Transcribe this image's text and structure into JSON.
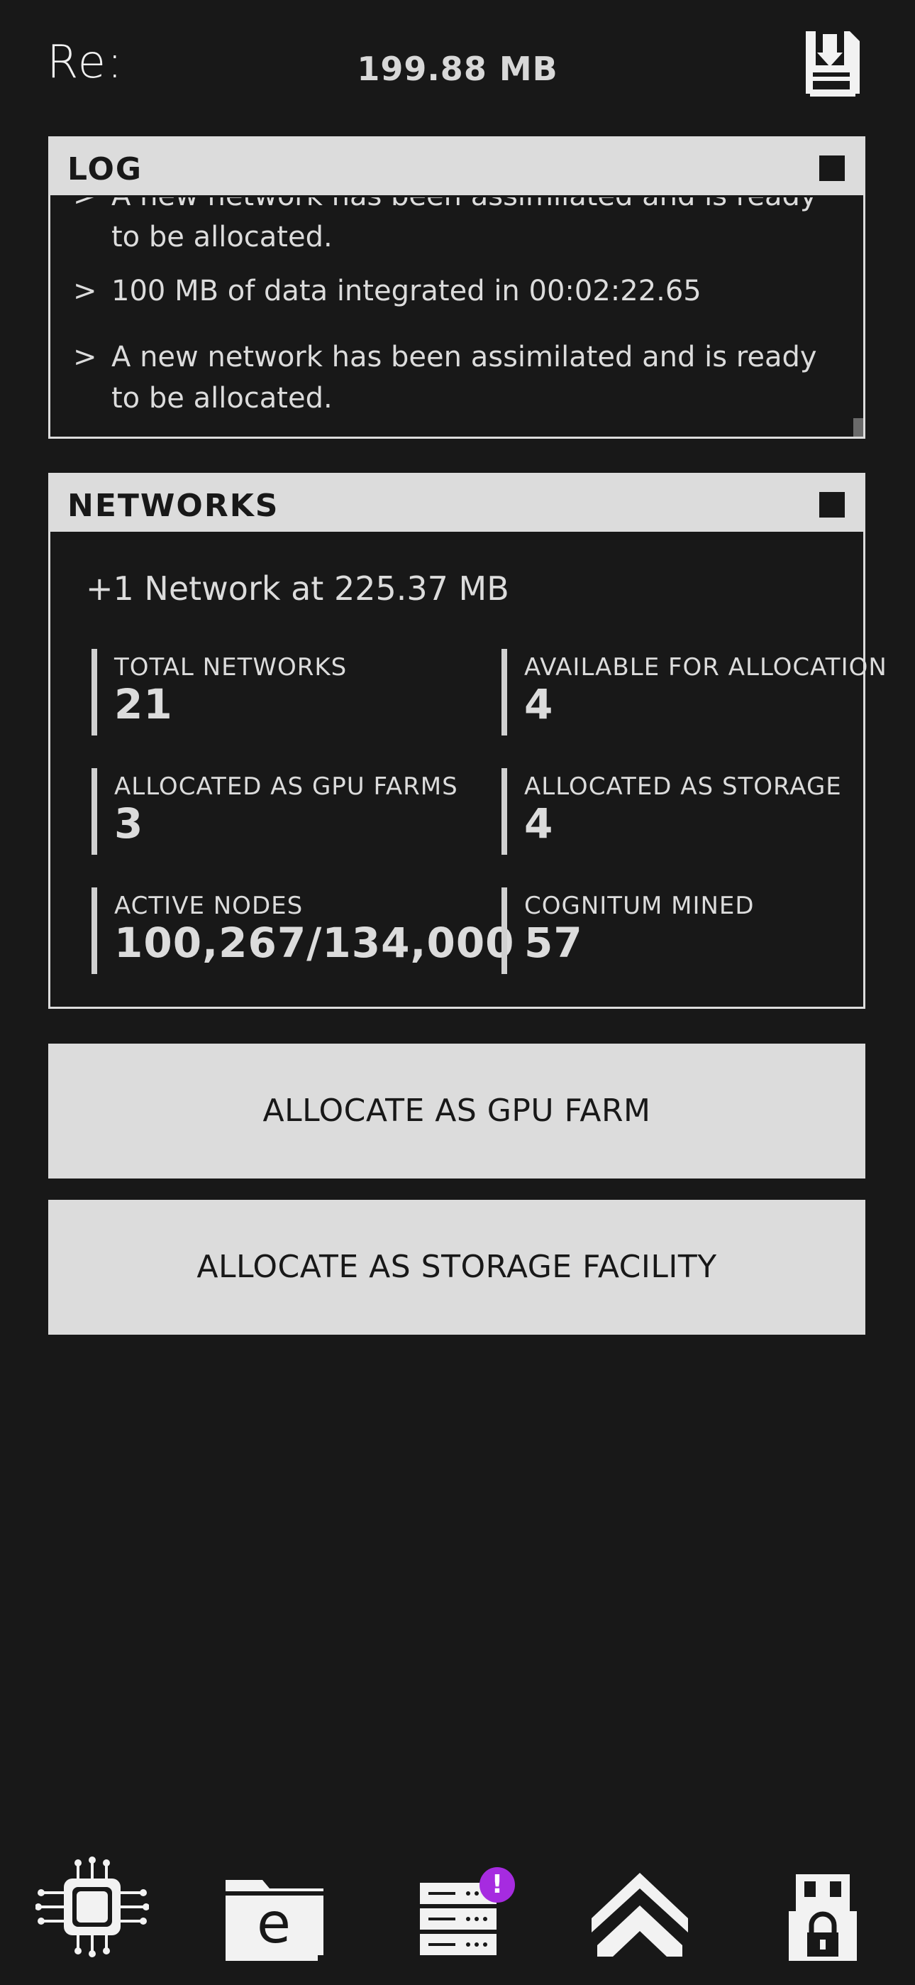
{
  "header": {
    "logo": "Re:",
    "storage": "199.88 MB",
    "save_icon": "download-tray-icon"
  },
  "log": {
    "title": "LOG",
    "entries": [
      {
        "caret": ">",
        "text": "A new network has been assimilated and is ready to be allocated."
      },
      {
        "caret": ">",
        "text": "100 MB of data integrated in 00:02:22.65"
      },
      {
        "caret": ">",
        "text": "A new network has been assimilated and is ready to be allocated."
      }
    ]
  },
  "networks": {
    "title": "NETWORKS",
    "headline": "+1 Network at 225.37 MB",
    "stats": {
      "total": {
        "label": "TOTAL NETWORKS",
        "value": "21"
      },
      "available": {
        "label": "AVAILABLE FOR ALLOCATION",
        "value": "4"
      },
      "gpu": {
        "label": "ALLOCATED AS GPU FARMS",
        "value": "3"
      },
      "storage": {
        "label": "ALLOCATED AS STORAGE",
        "value": "4"
      },
      "nodes": {
        "label": "ACTIVE NODES",
        "value": "100,267/134,000"
      },
      "cognitum": {
        "label": "COGNITUM MINED",
        "value": "57"
      }
    }
  },
  "actions": {
    "gpu_label": "ALLOCATE AS GPU FARM",
    "storage_label": "ALLOCATE AS STORAGE FACILITY"
  },
  "nav": {
    "items": [
      {
        "icon": "cpu-chip-icon"
      },
      {
        "icon": "folder-icon",
        "glyph": "e"
      },
      {
        "icon": "server-rack-icon",
        "badge": "!"
      },
      {
        "icon": "chevron-up-double-icon"
      },
      {
        "icon": "locked-usb-drive-icon"
      }
    ]
  },
  "colors": {
    "background": "#181818",
    "foreground": "#dcdcdc",
    "badge": "#a62be0"
  }
}
